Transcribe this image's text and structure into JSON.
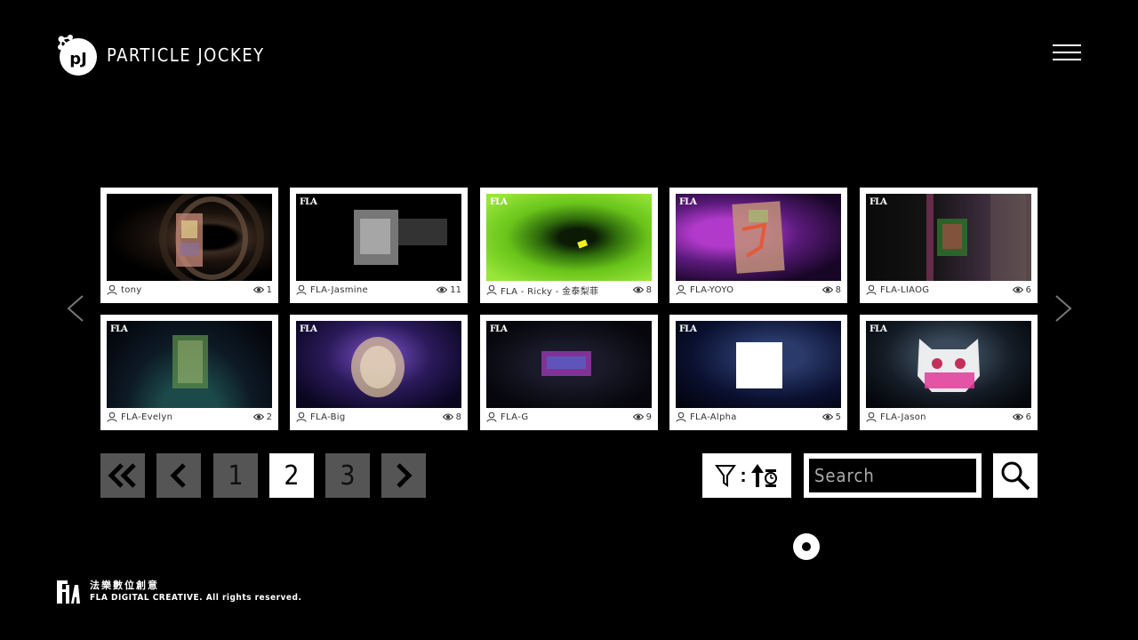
{
  "header": {
    "brand": "PARTICLE JOCKEY",
    "logo_icon": "pj-logo-icon",
    "menu_icon": "hamburger-menu-icon"
  },
  "gallery": {
    "items": [
      {
        "user": "tony",
        "views": "1",
        "watermark": ""
      },
      {
        "user": "FLA-Jasmine",
        "views": "11",
        "watermark": "FLA"
      },
      {
        "user": "FLA - Ricky - 金泰梨菲",
        "views": "8",
        "watermark": "FLA"
      },
      {
        "user": "FLA-YOYO",
        "views": "8",
        "watermark": "FLA"
      },
      {
        "user": "FLA-LIAOG",
        "views": "6",
        "watermark": "FLA"
      },
      {
        "user": "FLA-Evelyn",
        "views": "2",
        "watermark": "FLA"
      },
      {
        "user": "FLA-Big",
        "views": "8",
        "watermark": "FLA"
      },
      {
        "user": "FLA-G",
        "views": "9",
        "watermark": "FLA"
      },
      {
        "user": "FLA-Alpha",
        "views": "5",
        "watermark": "FLA"
      },
      {
        "user": "FLA-Jason",
        "views": "6",
        "watermark": "FLA"
      }
    ]
  },
  "pagination": {
    "pages": [
      "1",
      "2",
      "3"
    ],
    "current": "2"
  },
  "sort": {
    "separator": ":"
  },
  "search": {
    "placeholder": "Search"
  },
  "footer": {
    "cn": "法樂數位創意",
    "en": "FLA DIGITAL CREATIVE. All rights reserved."
  },
  "colors": {
    "background": "#000000",
    "card": "#ffffff",
    "page_button": "#555555"
  }
}
